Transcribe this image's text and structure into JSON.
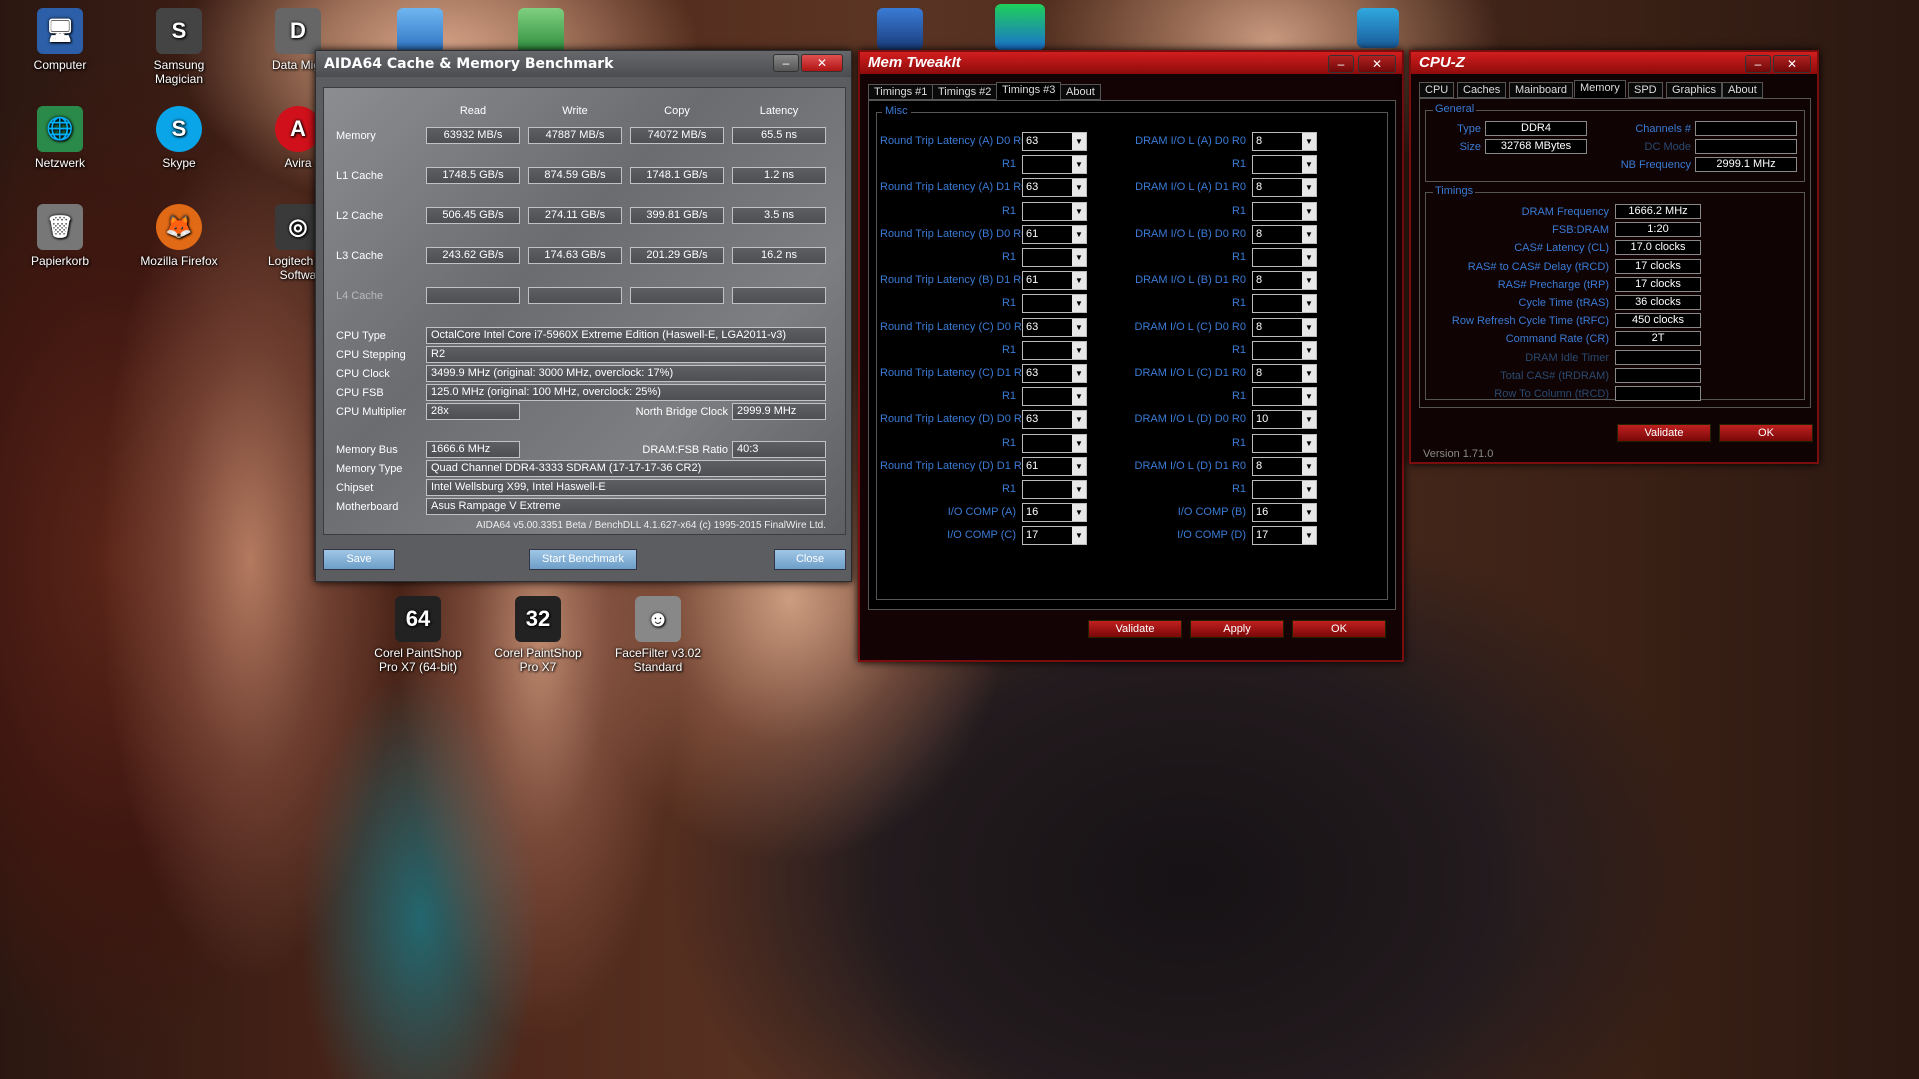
{
  "desktop": {
    "icons": [
      {
        "label": "Computer",
        "glyph": "🖥",
        "color": "#3a7bd5"
      },
      {
        "label": "Samsung Magician",
        "glyph": "S",
        "color": "#444"
      },
      {
        "label": "Data Migr",
        "glyph": "D",
        "color": "#666"
      },
      {
        "label": "Netzwerk",
        "glyph": "🌐",
        "color": "#2a8a4a"
      },
      {
        "label": "Skype",
        "glyph": "S",
        "color": "#0aa5e8"
      },
      {
        "label": "Avira",
        "glyph": "A",
        "color": "#d0101a"
      },
      {
        "label": "Papierkorb",
        "glyph": "🗑",
        "color": "#777"
      },
      {
        "label": "Mozilla Firefox",
        "glyph": "🦊",
        "color": "#e06a16"
      },
      {
        "label": "Logitech W Softwa",
        "glyph": "◎",
        "color": "#3a3a3a"
      },
      {
        "label": "Corel PaintShop Pro X7 (64-bit)",
        "glyph": "64",
        "color": "#222"
      },
      {
        "label": "Corel PaintShop Pro X7",
        "glyph": "32",
        "color": "#222"
      },
      {
        "label": "FaceFilter v3.02 Standard",
        "glyph": "☻",
        "color": "#888"
      }
    ]
  },
  "aida": {
    "title": "AIDA64 Cache & Memory Benchmark",
    "headers": [
      "Read",
      "Write",
      "Copy",
      "Latency"
    ],
    "rows": [
      {
        "label": "Memory",
        "values": [
          "63932 MB/s",
          "47887 MB/s",
          "74072 MB/s",
          "65.5 ns"
        ]
      },
      {
        "label": "L1 Cache",
        "values": [
          "1748.5 GB/s",
          "874.59 GB/s",
          "1748.1 GB/s",
          "1.2 ns"
        ]
      },
      {
        "label": "L2 Cache",
        "values": [
          "506.45 GB/s",
          "274.11 GB/s",
          "399.81 GB/s",
          "3.5 ns"
        ]
      },
      {
        "label": "L3 Cache",
        "values": [
          "243.62 GB/s",
          "174.63 GB/s",
          "201.29 GB/s",
          "16.2 ns"
        ]
      },
      {
        "label": "L4 Cache",
        "values": [
          "",
          "",
          "",
          ""
        ]
      }
    ],
    "cpu_type_label": "CPU Type",
    "cpu_type": "OctalCore Intel Core i7-5960X Extreme Edition  (Haswell-E, LGA2011-v3)",
    "cpu_stepping_label": "CPU Stepping",
    "cpu_stepping": "R2",
    "cpu_clock_label": "CPU Clock",
    "cpu_clock": "3499.9 MHz  (original: 3000 MHz, overclock: 17%)",
    "cpu_fsb_label": "CPU FSB",
    "cpu_fsb": "125.0 MHz  (original: 100 MHz, overclock: 25%)",
    "cpu_mult_label": "CPU Multiplier",
    "cpu_mult": "28x",
    "nb_clock_label": "North Bridge Clock",
    "nb_clock": "2999.9 MHz",
    "mem_bus_label": "Memory Bus",
    "mem_bus": "1666.6 MHz",
    "dram_ratio_label": "DRAM:FSB Ratio",
    "dram_ratio": "40:3",
    "mem_type_label": "Memory Type",
    "mem_type": "Quad Channel DDR4-3333 SDRAM  (17-17-17-36 CR2)",
    "chipset_label": "Chipset",
    "chipset": "Intel Wellsburg X99, Intel Haswell-E",
    "mobo_label": "Motherboard",
    "mobo": "Asus Rampage V Extreme",
    "footer": "AIDA64 v5.00.3351 Beta / BenchDLL 4.1.627-x64  (c) 1995-2015 FinalWire Ltd.",
    "save": "Save",
    "start": "Start Benchmark",
    "close": "Close"
  },
  "memtweak": {
    "title": "Mem TweakIt",
    "tabs": [
      "Timings #1",
      "Timings #2",
      "Timings #3",
      "About"
    ],
    "group": "Misc",
    "left": [
      {
        "label": "Round Trip Latency (A)  D0    R0",
        "value": "63"
      },
      {
        "label": "R1",
        "value": ""
      },
      {
        "label": "Round Trip Latency (A)  D1    R0",
        "value": "63"
      },
      {
        "label": "R1",
        "value": ""
      },
      {
        "label": "Round Trip Latency (B)  D0    R0",
        "value": "61"
      },
      {
        "label": "R1",
        "value": ""
      },
      {
        "label": "Round Trip Latency (B)  D1    R0",
        "value": "61"
      },
      {
        "label": "R1",
        "value": ""
      },
      {
        "label": "Round Trip Latency (C)  D0    R0",
        "value": "63"
      },
      {
        "label": "R1",
        "value": ""
      },
      {
        "label": "Round Trip Latency (C)  D1    R0",
        "value": "63"
      },
      {
        "label": "R1",
        "value": ""
      },
      {
        "label": "Round Trip Latency (D)  D0    R0",
        "value": "63"
      },
      {
        "label": "R1",
        "value": ""
      },
      {
        "label": "Round Trip Latency (D)  D1    R0",
        "value": "61"
      },
      {
        "label": "R1",
        "value": ""
      },
      {
        "label": "I/O COMP (A)",
        "value": "16"
      },
      {
        "label": "I/O COMP (C)",
        "value": "17"
      }
    ],
    "right": [
      {
        "label": "DRAM I/O L (A)  D0    R0",
        "value": "8"
      },
      {
        "label": "R1",
        "value": ""
      },
      {
        "label": "DRAM I/O L (A)  D1    R0",
        "value": "8"
      },
      {
        "label": "R1",
        "value": ""
      },
      {
        "label": "DRAM I/O L (B)  D0    R0",
        "value": "8"
      },
      {
        "label": "R1",
        "value": ""
      },
      {
        "label": "DRAM I/O L (B)  D1    R0",
        "value": "8"
      },
      {
        "label": "R1",
        "value": ""
      },
      {
        "label": "DRAM I/O L (C)  D0    R0",
        "value": "8"
      },
      {
        "label": "R1",
        "value": ""
      },
      {
        "label": "DRAM I/O L (C)  D1    R0",
        "value": "8"
      },
      {
        "label": "R1",
        "value": ""
      },
      {
        "label": "DRAM I/O L (D)  D0    R0",
        "value": "10"
      },
      {
        "label": "R1",
        "value": ""
      },
      {
        "label": "DRAM I/O L (D)  D1    R0",
        "value": "8"
      },
      {
        "label": "R1",
        "value": ""
      },
      {
        "label": "I/O COMP (B)",
        "value": "16"
      },
      {
        "label": "I/O COMP (D)",
        "value": "17"
      }
    ],
    "validate": "Validate",
    "apply": "Apply",
    "ok": "OK"
  },
  "cpuz": {
    "title": "CPU-Z",
    "tabs": [
      "CPU",
      "Caches",
      "Mainboard",
      "Memory",
      "SPD",
      "Graphics",
      "About"
    ],
    "general_label": "General",
    "type_label": "Type",
    "type": "DDR4",
    "size_label": "Size",
    "size": "32768 MBytes",
    "channels_label": "Channels #",
    "channels": "",
    "dc_label": "DC Mode",
    "dc": "",
    "nb_label": "NB Frequency",
    "nb": "2999.1 MHz",
    "timings_label": "Timings",
    "timings": [
      {
        "label": "DRAM Frequency",
        "value": "1666.2 MHz"
      },
      {
        "label": "FSB:DRAM",
        "value": "1:20"
      },
      {
        "label": "CAS# Latency (CL)",
        "value": "17.0 clocks"
      },
      {
        "label": "RAS# to CAS# Delay (tRCD)",
        "value": "17 clocks"
      },
      {
        "label": "RAS# Precharge (tRP)",
        "value": "17 clocks"
      },
      {
        "label": "Cycle Time (tRAS)",
        "value": "36 clocks"
      },
      {
        "label": "Row Refresh Cycle Time (tRFC)",
        "value": "450 clocks"
      },
      {
        "label": "Command Rate (CR)",
        "value": "2T"
      },
      {
        "label": "DRAM Idle Timer",
        "value": ""
      },
      {
        "label": "Total CAS# (tRDRAM)",
        "value": ""
      },
      {
        "label": "Row To Column (tRCD)",
        "value": ""
      }
    ],
    "validate": "Validate",
    "ok": "OK",
    "version": "Version 1.71.0"
  }
}
